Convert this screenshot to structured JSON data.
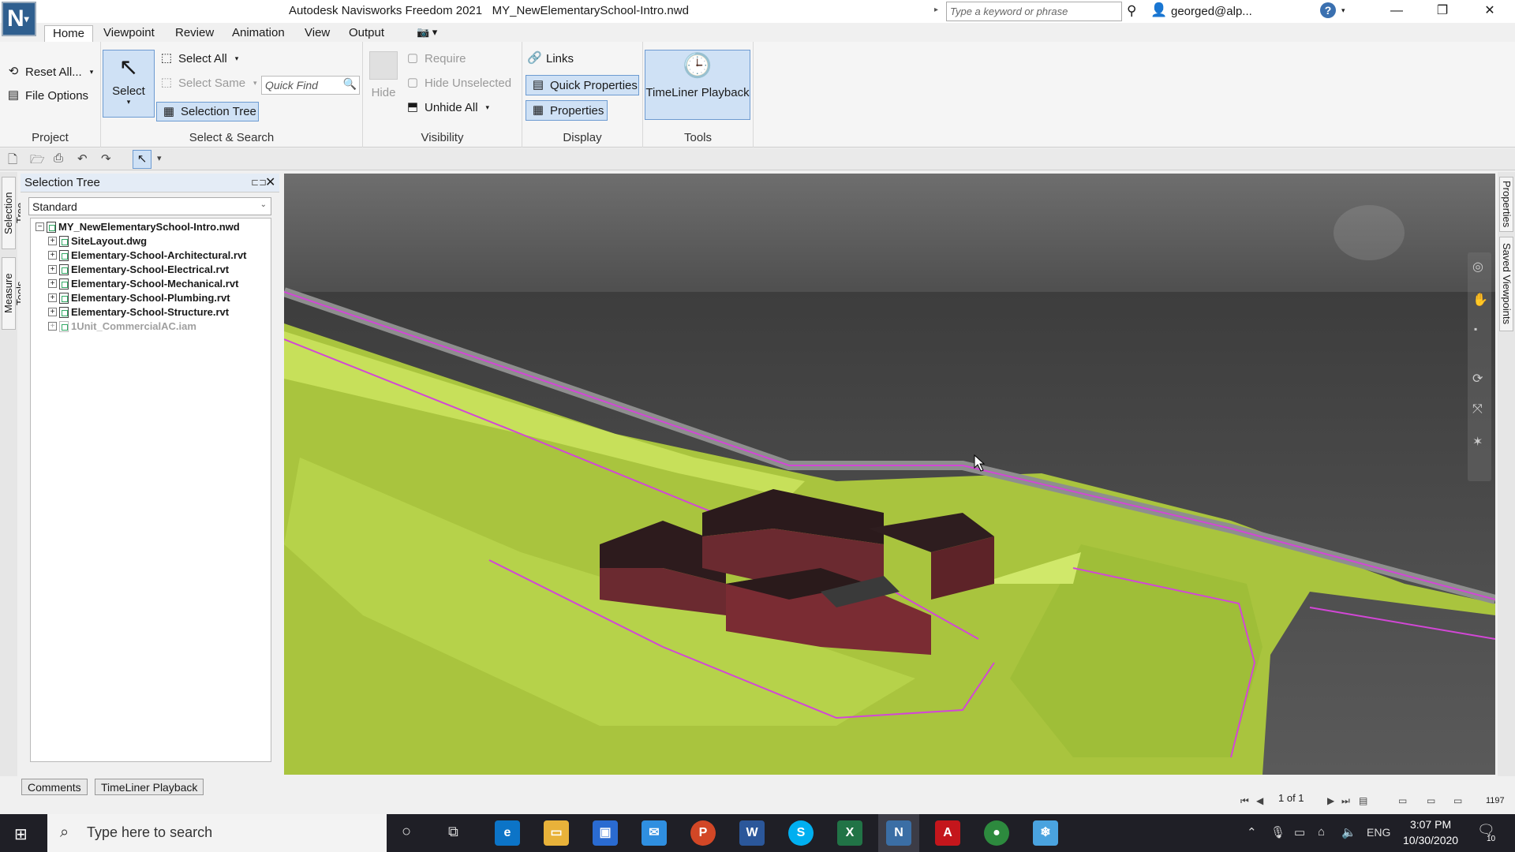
{
  "titlebar": {
    "app_title": "Autodesk Navisworks Freedom 2021",
    "document": "MY_NewElementarySchool-Intro.nwd",
    "search_placeholder": "Type a keyword or phrase",
    "user": "georged@alp...",
    "logo": "N"
  },
  "menu": {
    "tabs": [
      "Home",
      "Viewpoint",
      "Review",
      "Animation",
      "View",
      "Output"
    ],
    "active": "Home"
  },
  "ribbon": {
    "project": {
      "title": "Project",
      "reset_all": "Reset All...",
      "file_options": "File Options"
    },
    "select_search": {
      "title": "Select & Search",
      "select": "Select",
      "select_all": "Select All",
      "select_same": "Select Same",
      "quick_find": "Quick Find",
      "selection_tree": "Selection Tree"
    },
    "visibility": {
      "title": "Visibility",
      "hide": "Hide",
      "require": "Require",
      "hide_unselected": "Hide Unselected",
      "unhide_all": "Unhide All"
    },
    "display": {
      "title": "Display",
      "links": "Links",
      "quick_properties": "Quick Properties",
      "properties": "Properties"
    },
    "tools": {
      "title": "Tools",
      "timeliner_playback": "TimeLiner Playback"
    }
  },
  "side_tabs": {
    "left": [
      "Selection Tree",
      "Measure Tools"
    ],
    "right": [
      "Properties",
      "Saved Viewpoints"
    ]
  },
  "selection_tree": {
    "title": "Selection Tree",
    "mode": "Standard",
    "root": "MY_NewElementarySchool-Intro.nwd",
    "items": [
      {
        "name": "SiteLayout.dwg",
        "hidden": false
      },
      {
        "name": "Elementary-School-Architectural.rvt",
        "hidden": false
      },
      {
        "name": "Elementary-School-Electrical.rvt",
        "hidden": false
      },
      {
        "name": "Elementary-School-Mechanical.rvt",
        "hidden": false
      },
      {
        "name": "Elementary-School-Plumbing.rvt",
        "hidden": false
      },
      {
        "name": "Elementary-School-Structure.rvt",
        "hidden": false
      },
      {
        "name": "1Unit_CommercialAC.iam",
        "hidden": true
      }
    ]
  },
  "bottom_tabs": [
    "Comments",
    "TimeLiner Playback"
  ],
  "status": {
    "page": "1 of 1",
    "memory": "1197"
  },
  "taskbar": {
    "search_placeholder": "Type here to search",
    "time": "3:07 PM",
    "date": "10/30/2020",
    "language": "ENG",
    "notifications": "10"
  },
  "colors": {
    "ribbon_active_bg": "#cfe1f5",
    "ribbon_active_border": "#6d9bd1",
    "terrain": "#b9d64a",
    "building": "#6b2a30",
    "road_line": "#e040e8",
    "taskbar_bg": "#1f1f26"
  }
}
